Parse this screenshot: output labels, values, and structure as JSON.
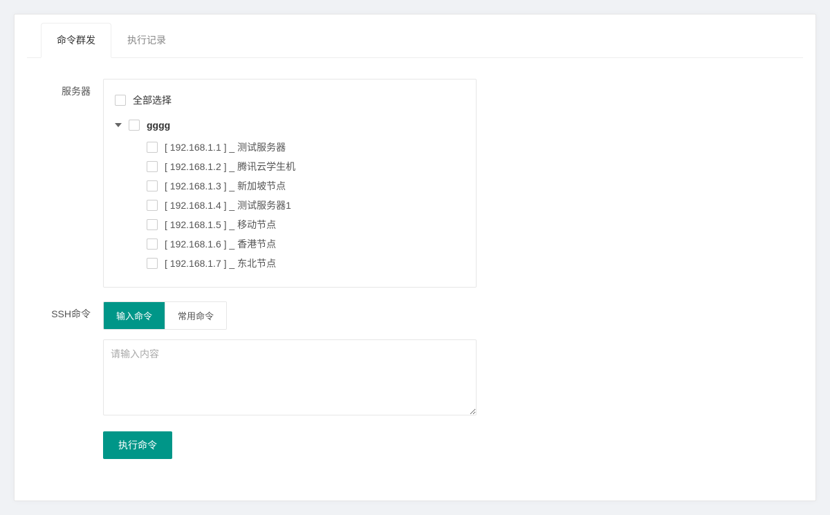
{
  "tabs": {
    "broadcast": "命令群发",
    "history": "执行记录"
  },
  "form": {
    "server_label": "服务器",
    "ssh_label": "SSH命令"
  },
  "tree": {
    "select_all": "全部选择",
    "group_name": "gggg",
    "items": [
      "[ 192.168.1.1 ] _ 测试服务器",
      "[ 192.168.1.2 ] _ 腾讯云学生机",
      "[ 192.168.1.3 ] _ 新加坡节点",
      "[ 192.168.1.4 ] _ 测试服务器1",
      "[ 192.168.1.5 ] _ 移动节点",
      "[ 192.168.1.6 ] _ 香港节点",
      "[ 192.168.1.7 ] _ 东北节点"
    ]
  },
  "ssh": {
    "input_tab": "输入命令",
    "common_tab": "常用命令",
    "placeholder": "请输入内容"
  },
  "actions": {
    "execute": "执行命令"
  }
}
